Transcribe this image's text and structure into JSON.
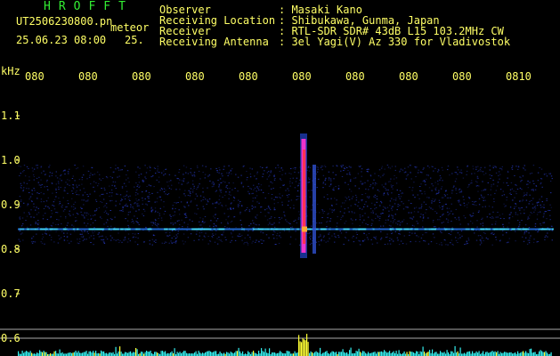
{
  "header": {
    "logo": "HROFFT",
    "file_name": "UT2506230800.pn",
    "meteor_label": "meteor",
    "date_time": "25.06.23 08:00",
    "count": "25."
  },
  "info": [
    {
      "label": "Observer",
      "value": ": Masaki Kano"
    },
    {
      "label": "Receiving Location",
      "value": ": Shibukawa, Gunma, Japan"
    },
    {
      "label": "Receiver",
      "value": ": RTL-SDR SDR# 43dB L15 103.2MHz CW"
    },
    {
      "label": "Receiving Antenna",
      "value": ": 3el Yagi(V) Az 330 for Vladivostok"
    }
  ],
  "colors": {
    "text_yellow": "#ffff66",
    "logo_green": "#33ee33",
    "noise_blue": "#2233aa",
    "signal_cyan": "#44ddff",
    "meteor_red": "#ff3355",
    "meteor_magenta": "#ee33cc",
    "level_cyan": "#33eeee",
    "level_yellow": "#ffff33",
    "background": "#000000"
  },
  "chart_data": {
    "type": "heatmap",
    "y_unit": "kHz",
    "y_ticks": [
      "1.1",
      "1.0",
      "0.9",
      "0.8",
      "0.7",
      "0.6"
    ],
    "y_range": [
      0.6,
      1.1
    ],
    "x_ticks": [
      "080",
      "080",
      "080",
      "080",
      "080",
      "080",
      "080",
      "080",
      "080",
      "0810"
    ],
    "x_range_minutes": [
      0,
      10
    ],
    "noise_band_khz": [
      0.81,
      0.99
    ],
    "carrier_line_khz": 0.845,
    "meteor_echo": {
      "time_minute": 5.35,
      "freq_range_khz": [
        0.78,
        1.06
      ]
    },
    "secondary_trace": {
      "time_minute": 5.55,
      "freq_range_khz": [
        0.79,
        0.99
      ]
    },
    "level_meter": "signal strength bars along bottom; peak at the meteor echo time"
  }
}
